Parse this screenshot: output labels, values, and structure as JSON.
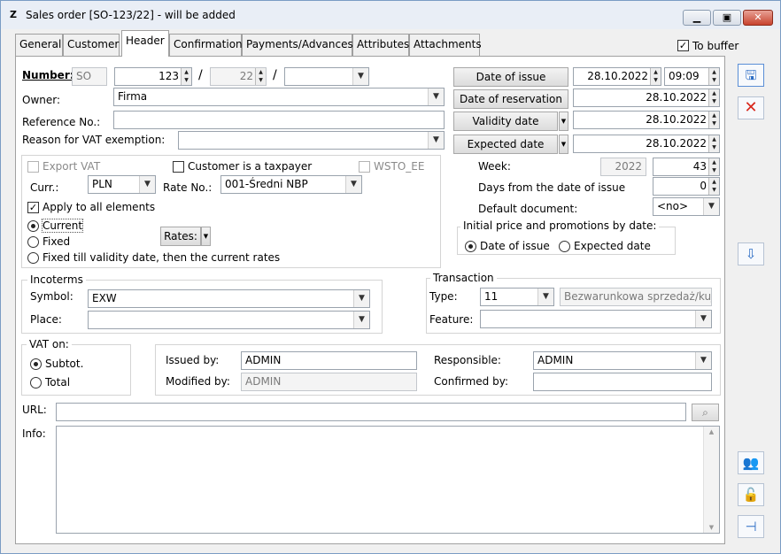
{
  "window": {
    "title": "Sales order [SO-123/22] - will be added",
    "app_icon": "Z",
    "controls": {
      "minimize": "minimize-icon",
      "maximize": "maximize-icon",
      "close": "close-icon"
    }
  },
  "tabs": [
    "General",
    "Customer",
    "Header",
    "Confirmation",
    "Payments/Advances",
    "Attributes",
    "Attachments"
  ],
  "active_tab": "Header",
  "to_buffer": {
    "label": "To buffer",
    "checked": true
  },
  "number": {
    "label": "Number:",
    "prefix": "SO",
    "number": "123",
    "sep1": "/",
    "year": "22",
    "sep2": "/",
    "suffix": ""
  },
  "owner": {
    "label": "Owner:",
    "value": "Firma"
  },
  "reference": {
    "label": "Reference No.:",
    "value": ""
  },
  "vat_exempt": {
    "label": "Reason for VAT exemption:",
    "value": ""
  },
  "dates": {
    "issue": {
      "button": "Date of issue",
      "date": "28.10.2022",
      "time": "09:09"
    },
    "reservation": {
      "button": "Date of reservation",
      "date": "28.10.2022"
    },
    "validity": {
      "button": "Validity date",
      "date": "28.10.2022"
    },
    "expected": {
      "button": "Expected date",
      "date": "28.10.2022"
    }
  },
  "week": {
    "label": "Week:",
    "year": "2022",
    "week": "43"
  },
  "days_from_issue": {
    "label": "Days from the date of issue",
    "value": "0"
  },
  "default_document": {
    "label": "Default document:",
    "value": "<no>"
  },
  "initial_price": {
    "title": "Initial price and promotions by date:",
    "opt1": "Date of issue",
    "opt2": "Expected date",
    "selected": "Date of issue"
  },
  "currency": {
    "export_vat": "Export VAT",
    "taxpayer": "Customer is a taxpayer",
    "wsto": "WSTO_EE",
    "curr_label": "Curr.:",
    "curr_value": "PLN",
    "rate_label": "Rate No.:",
    "rate_value": "001-Średni NBP",
    "apply_all": "Apply to all elements",
    "apply_all_checked": true,
    "opt_current": "Current",
    "opt_fixed": "Fixed",
    "opt_fixed_till": "Fixed till validity date, then the current rates",
    "selected": "Current",
    "rates_button": "Rates:"
  },
  "incoterms": {
    "title": "Incoterms",
    "symbol_label": "Symbol:",
    "symbol_value": "EXW",
    "place_label": "Place:",
    "place_value": ""
  },
  "transaction": {
    "title": "Transaction",
    "type_label": "Type:",
    "type_value": "11",
    "type_desc": "Bezwarunkowa sprzedaż/kuj",
    "feature_label": "Feature:",
    "feature_value": ""
  },
  "vat_on": {
    "title": "VAT on:",
    "opt1": "Subtot.",
    "opt2": "Total",
    "selected": "Subtot."
  },
  "people": {
    "issued_label": "Issued by:",
    "issued_value": "ADMIN",
    "modified_label": "Modified by:",
    "modified_value": "ADMIN",
    "responsible_label": "Responsible:",
    "responsible_value": "ADMIN",
    "confirmed_label": "Confirmed by:",
    "confirmed_value": ""
  },
  "url": {
    "label": "URL:",
    "value": ""
  },
  "info": {
    "label": "Info:",
    "value": ""
  },
  "side_buttons": [
    "save-icon",
    "cancel-icon",
    "export-icon",
    "users-icon",
    "lock-icon",
    "pin-icon"
  ],
  "colors": {
    "accent": "#2b6cc4",
    "cancel": "#d8271c"
  }
}
